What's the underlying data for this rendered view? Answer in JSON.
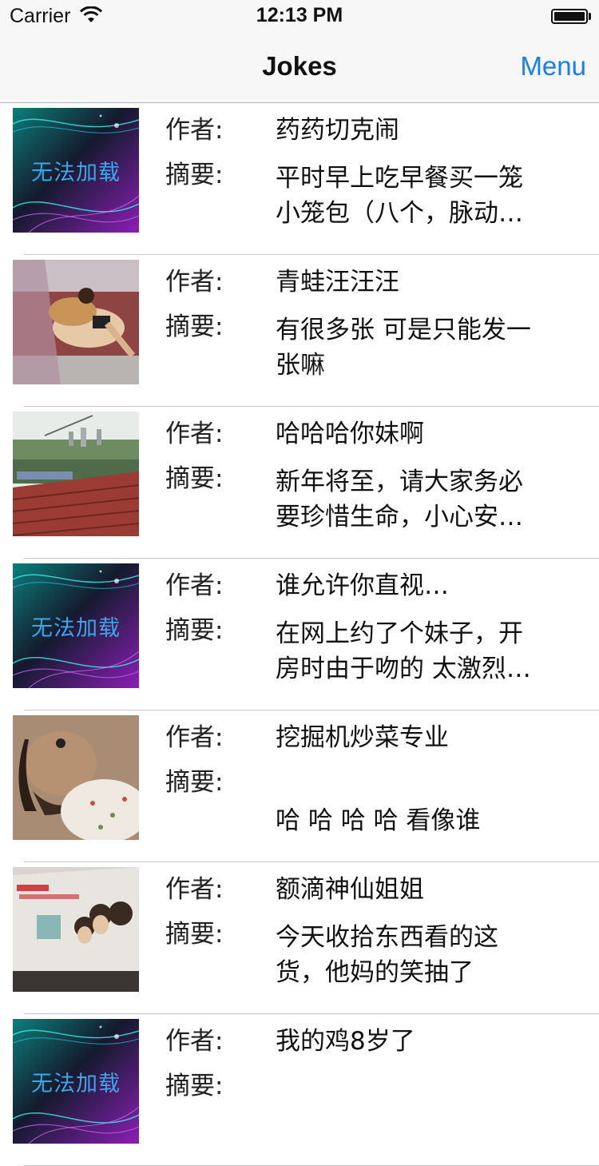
{
  "status": {
    "carrier": "Carrier",
    "time": "12:13 PM"
  },
  "nav": {
    "title": "Jokes",
    "menu_label": "Menu"
  },
  "labels": {
    "author": "作者:",
    "summary": "摘要:"
  },
  "placeholder_text": "无法加载",
  "jokes": [
    {
      "author": "药药切克闹",
      "summary_lines": [
        "平时早上吃早餐买一笼",
        "小笼包（八个，脉动…"
      ],
      "image": "placeholder"
    },
    {
      "author": "青蛙汪汪汪",
      "summary_lines": [
        "有很多张 可是只能发一",
        "张嘛"
      ],
      "image": "photo-woman-dog"
    },
    {
      "author": "哈哈哈你妹啊",
      "summary_lines": [
        "新年将至，请大家务必",
        "要珍惜生命，小心安…"
      ],
      "image": "photo-rooftop"
    },
    {
      "author": "谁允许你直视…",
      "summary_lines": [
        "在网上约了个妹子，开",
        "房时由于吻的 太激烈…"
      ],
      "image": "placeholder"
    },
    {
      "author": "挖掘机炒菜专业",
      "summary_lines": [
        "",
        "哈 哈 哈 哈 看像谁"
      ],
      "image": "photo-sleeping-face"
    },
    {
      "author": "额滴神仙姐姐",
      "summary_lines": [
        "今天收拾东西看的这",
        "货，他妈的笑抽了"
      ],
      "image": "photo-bag"
    },
    {
      "author": "我的鸡8岁了",
      "summary_lines": [
        "",
        ""
      ],
      "image": "placeholder"
    }
  ]
}
